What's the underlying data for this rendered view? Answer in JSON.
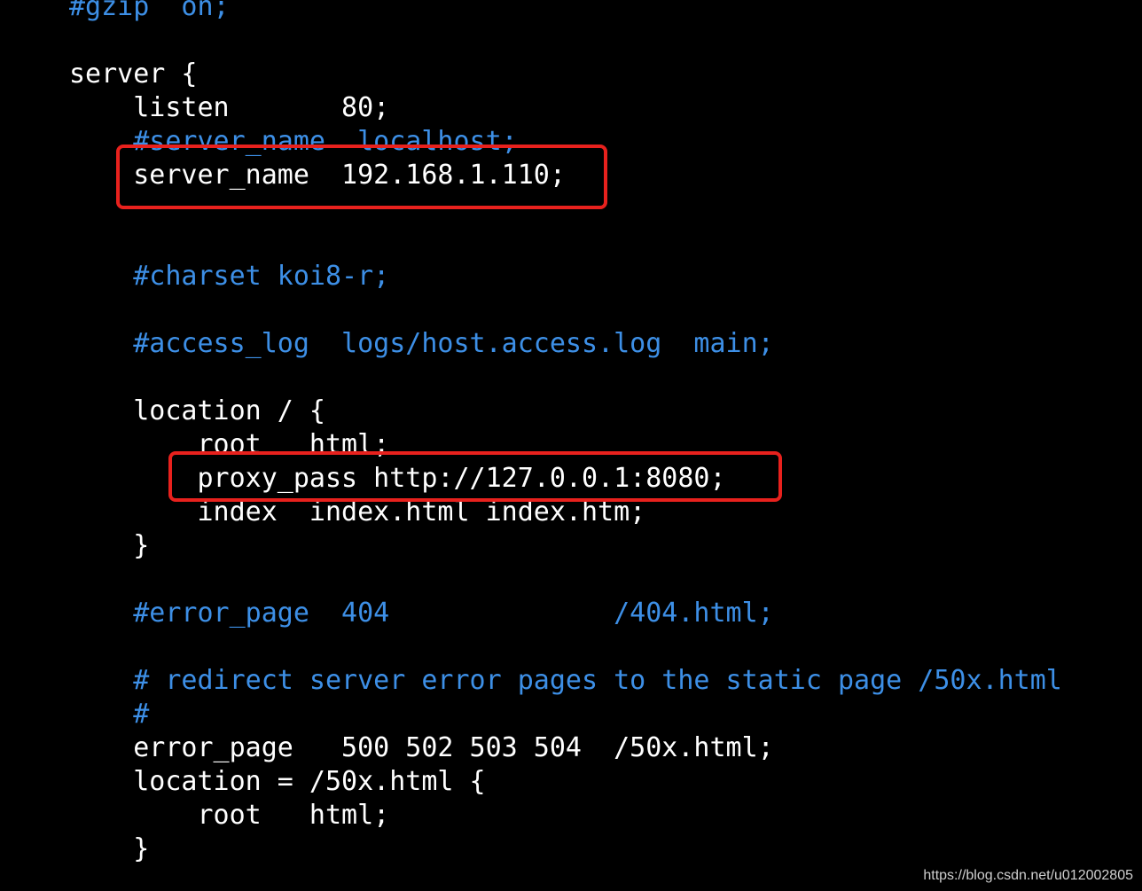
{
  "editor": {
    "lines": [
      {
        "text": "#gzip  on;",
        "kind": "comment"
      },
      {
        "text": "",
        "kind": "default"
      },
      {
        "text": "server {",
        "kind": "default"
      },
      {
        "text": "    listen       80;",
        "kind": "default"
      },
      {
        "text": "    #server_name  localhost;",
        "kind": "comment"
      },
      {
        "text": "    server_name  192.168.1.110;",
        "kind": "default"
      },
      {
        "text": "",
        "kind": "default"
      },
      {
        "text": "",
        "kind": "default"
      },
      {
        "text": "    #charset koi8-r;",
        "kind": "comment"
      },
      {
        "text": "",
        "kind": "default"
      },
      {
        "text": "    #access_log  logs/host.access.log  main;",
        "kind": "comment"
      },
      {
        "text": "",
        "kind": "default"
      },
      {
        "text": "    location / {",
        "kind": "default"
      },
      {
        "text": "        root   html;",
        "kind": "default"
      },
      {
        "text": "        proxy_pass http://127.0.0.1:8080;",
        "kind": "default"
      },
      {
        "text": "        index  index.html index.htm;",
        "kind": "default"
      },
      {
        "text": "    }",
        "kind": "default"
      },
      {
        "text": "",
        "kind": "default"
      },
      {
        "text": "    #error_page  404              /404.html;",
        "kind": "comment"
      },
      {
        "text": "",
        "kind": "default"
      },
      {
        "text": "    # redirect server error pages to the static page /50x.html",
        "kind": "comment"
      },
      {
        "text": "    #",
        "kind": "comment"
      },
      {
        "text": "    error_page   500 502 503 504  /50x.html;",
        "kind": "default"
      },
      {
        "text": "    location = /50x.html {",
        "kind": "default"
      },
      {
        "text": "        root   html;",
        "kind": "default"
      },
      {
        "text": "    }",
        "kind": "default"
      }
    ]
  },
  "watermark": "https://blog.csdn.net/u012002805",
  "colors": {
    "background": "#000000",
    "text": "#ffffff",
    "comment": "#3d8fe6",
    "highlight": "#e8211d"
  }
}
